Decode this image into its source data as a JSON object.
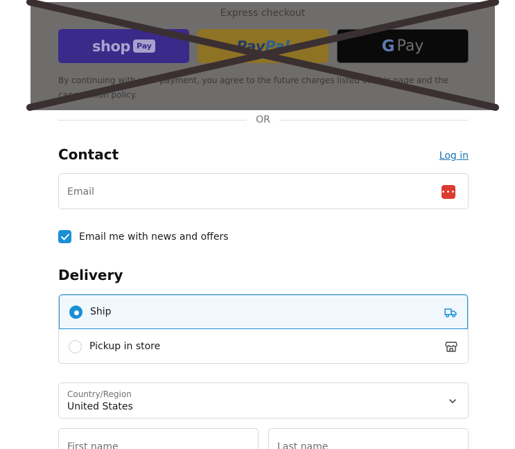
{
  "express": {
    "title": "Express checkout",
    "shop_pay": {
      "brand": "shop",
      "chip": "Pay"
    },
    "paypal": {
      "part1": "Pay",
      "part2": "Pal"
    },
    "gpay": {
      "g": "G",
      "word": "Pay"
    },
    "note": "By continuing with your payment, you agree to the future charges listed on this page and the cancellation policy."
  },
  "divider": {
    "text": "OR"
  },
  "contact": {
    "title": "Contact",
    "login_link": "Log in",
    "email_placeholder": "Email",
    "password_manager_icon": "password-manager-icon",
    "newsletter_label": "Email me with news and offers",
    "newsletter_checked": true
  },
  "delivery": {
    "title": "Delivery",
    "options": [
      {
        "label": "Ship",
        "selected": true,
        "icon": "truck-icon"
      },
      {
        "label": "Pickup in store",
        "selected": false,
        "icon": "store-icon"
      }
    ],
    "country_label": "Country/Region",
    "country_value": "United States",
    "first_name_placeholder": "First name",
    "last_name_placeholder": "Last name"
  },
  "colors": {
    "accent": "#1a8fd6",
    "link": "#1773b0",
    "selected_bg": "#f0f8fd",
    "border": "#d9d9d9",
    "overlay": "#6f6c6c",
    "cross": "#3a3032"
  }
}
